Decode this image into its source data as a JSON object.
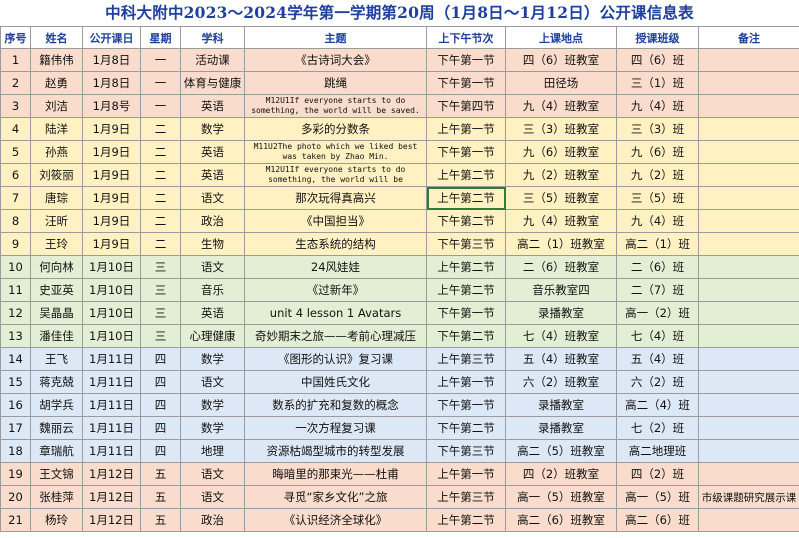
{
  "title": "中科大附中2023～2024学年第一学期第20周（1月8日～1月12日）公开课信息表",
  "headers": [
    "序号",
    "姓名",
    "公开课日",
    "星期",
    "学科",
    "主题",
    "上下午节次",
    "上课地点",
    "授课班级",
    "备注"
  ],
  "rows": [
    {
      "no": "1",
      "name": "籍伟伟",
      "date": "1月8日",
      "weekday": "一",
      "subject": "活动课",
      "topic": "《古诗词大会》",
      "period": "下午第一节",
      "location": "四（6）班教室",
      "class": "四（6）班",
      "note": "",
      "day": 1
    },
    {
      "no": "2",
      "name": "赵勇",
      "date": "1月8日",
      "weekday": "一",
      "subject": "体育与健康",
      "topic": "跳绳",
      "period": "下午第一节",
      "location": "田径场",
      "class": "三（1）班",
      "note": "",
      "day": 1
    },
    {
      "no": "3",
      "name": "刘洁",
      "date": "1月8号",
      "weekday": "一",
      "subject": "英语",
      "topic": "M12U1If everyone starts to do something, the world will be saved.",
      "period": "下午第四节",
      "location": "九（4）班教室",
      "class": "九（4）班",
      "note": "",
      "day": 1,
      "mono": true
    },
    {
      "no": "4",
      "name": "陆洋",
      "date": "1月9日",
      "weekday": "二",
      "subject": "数学",
      "topic": "多彩的分数条",
      "period": "上午第一节",
      "location": "三（3）班教室",
      "class": "三（3）班",
      "note": "",
      "day": 2
    },
    {
      "no": "5",
      "name": "孙燕",
      "date": "1月9日",
      "weekday": "二",
      "subject": "英语",
      "topic": "M11U2The photo which we liked best was taken by Zhao Min.",
      "period": "下午第一节",
      "location": "九（6）班教室",
      "class": "九（6）班",
      "note": "",
      "day": 2,
      "mono": true
    },
    {
      "no": "6",
      "name": "刘筱丽",
      "date": "1月9日",
      "weekday": "二",
      "subject": "英语",
      "topic": "M12U1If everyone starts to do something, the world will be",
      "period": "上午第二节",
      "location": "九（2）班教室",
      "class": "九（2）班",
      "note": "",
      "day": 2,
      "mono": true
    },
    {
      "no": "7",
      "name": "唐琮",
      "date": "1月9日",
      "weekday": "二",
      "subject": "语文",
      "topic": "那次玩得真高兴",
      "period": "上午第二节",
      "location": "三（5）班教室",
      "class": "三（5）班",
      "note": "",
      "day": 2,
      "selected": true
    },
    {
      "no": "8",
      "name": "汪昕",
      "date": "1月9日",
      "weekday": "二",
      "subject": "政治",
      "topic": "《中国担当》",
      "period": "下午第二节",
      "location": "九（4）班教室",
      "class": "九（4）班",
      "note": "",
      "day": 2
    },
    {
      "no": "9",
      "name": "王玲",
      "date": "1月9日",
      "weekday": "二",
      "subject": "生物",
      "topic": "生态系统的结构",
      "period": "下午第三节",
      "location": "高二（1）班教室",
      "class": "高二（1）班",
      "note": "",
      "day": 2
    },
    {
      "no": "10",
      "name": "何向林",
      "date": "1月10日",
      "weekday": "三",
      "subject": "语文",
      "topic": "24风娃娃",
      "period": "上午第二节",
      "location": "二（6）班教室",
      "class": "二（6）班",
      "note": "",
      "day": 3
    },
    {
      "no": "11",
      "name": "史亚英",
      "date": "1月10日",
      "weekday": "三",
      "subject": "音乐",
      "topic": "《过新年》",
      "period": "上午第二节",
      "location": "音乐教室四",
      "class": "二（7）班",
      "note": "",
      "day": 3
    },
    {
      "no": "12",
      "name": "吴晶晶",
      "date": "1月10日",
      "weekday": "三",
      "subject": "英语",
      "topic": "unit 4 lesson 1 Avatars",
      "period": "下午第一节",
      "location": "录播教室",
      "class": "高一（2）班",
      "note": "",
      "day": 3
    },
    {
      "no": "13",
      "name": "潘佳佳",
      "date": "1月10日",
      "weekday": "三",
      "subject": "心理健康",
      "topic": "奇妙期末之旅——考前心理减压",
      "period": "下午第二节",
      "location": "七（4）班教室",
      "class": "七（4）班",
      "note": "",
      "day": 3
    },
    {
      "no": "14",
      "name": "王飞",
      "date": "1月11日",
      "weekday": "四",
      "subject": "数学",
      "topic": "《图形的认识》复习课",
      "period": "上午第三节",
      "location": "五（4）班教室",
      "class": "五（4）班",
      "note": "",
      "day": 4
    },
    {
      "no": "15",
      "name": "蒋克兢",
      "date": "1月11日",
      "weekday": "四",
      "subject": "语文",
      "topic": "中国姓氏文化",
      "period": "上午第一节",
      "location": "六（2）班教室",
      "class": "六（2）班",
      "note": "",
      "day": 4
    },
    {
      "no": "16",
      "name": "胡学兵",
      "date": "1月11日",
      "weekday": "四",
      "subject": "数学",
      "topic": "数系的扩充和复数的概念",
      "period": "下午第一节",
      "location": "录播教室",
      "class": "高二（4）班",
      "note": "",
      "day": 4
    },
    {
      "no": "17",
      "name": "魏丽云",
      "date": "1月11日",
      "weekday": "四",
      "subject": "数学",
      "topic": "一次方程复习课",
      "period": "下午第二节",
      "location": "录播教室",
      "class": "七（2）班",
      "note": "",
      "day": 4
    },
    {
      "no": "18",
      "name": "章瑞航",
      "date": "1月11日",
      "weekday": "四",
      "subject": "地理",
      "topic": "资源枯竭型城市的转型发展",
      "period": "下午第三节",
      "location": "高二（5）班教室",
      "class": "高二地理班",
      "note": "",
      "day": 4
    },
    {
      "no": "19",
      "name": "王文锦",
      "date": "1月12日",
      "weekday": "五",
      "subject": "语文",
      "topic": "晦暗里的那束光——杜甫",
      "period": "上午第一节",
      "location": "四（2）班教室",
      "class": "四（2）班",
      "note": "",
      "day": 5
    },
    {
      "no": "20",
      "name": "张桂萍",
      "date": "1月12日",
      "weekday": "五",
      "subject": "语文",
      "topic": "寻觅“家乡文化”之旅",
      "period": "上午第三节",
      "location": "高一（5）班教室",
      "class": "高一（5）班",
      "note": "市级课题研究展示课",
      "day": 5
    },
    {
      "no": "21",
      "name": "杨玲",
      "date": "1月12日",
      "weekday": "五",
      "subject": "政治",
      "topic": "《认识经济全球化》",
      "period": "上午第二节",
      "location": "高二（6）班教室",
      "class": "高二（6）班",
      "note": "",
      "day": 5
    }
  ]
}
